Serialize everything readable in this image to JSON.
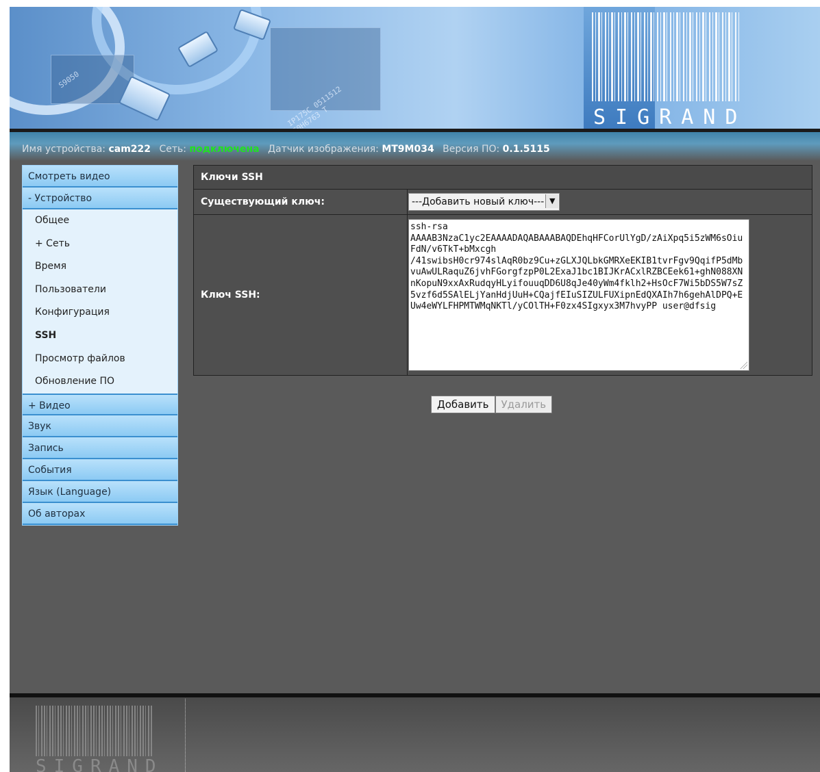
{
  "header": {
    "logo_text": "SIGRAND",
    "chip_marking_1": "S9050",
    "chip_marking_2": "IP175C 0511512 F0H6763 T"
  },
  "status": {
    "device_label": "Имя устройства:",
    "device_name": "cam222",
    "network_label": "Сеть:",
    "network_state": "подключена",
    "network_state_color": "#22e022",
    "sensor_label": "Датчик изображения:",
    "sensor_value": "MT9M034",
    "firmware_label": "Версия ПО:",
    "firmware_value": "0.1.5115"
  },
  "sidebar": {
    "items": [
      {
        "label": "Смотреть видео"
      },
      {
        "label": "- Устройство"
      }
    ],
    "submenu": [
      {
        "label": "Общее"
      },
      {
        "label": "+ Сеть"
      },
      {
        "label": "Время"
      },
      {
        "label": "Пользователи"
      },
      {
        "label": "Конфигурация"
      },
      {
        "label": "SSH",
        "active": true
      },
      {
        "label": "Просмотр файлов"
      },
      {
        "label": "Обновление ПО"
      }
    ],
    "items_after": [
      {
        "label": "+ Видео"
      },
      {
        "label": "Звук"
      },
      {
        "label": "Запись"
      },
      {
        "label": "События"
      },
      {
        "label": "Язык (Language)"
      },
      {
        "label": "Об авторах"
      }
    ]
  },
  "main": {
    "section_title": "Ключи SSH",
    "existing_key_label": "Существующий ключ:",
    "existing_key_select_value": "---Добавить новый ключ---",
    "ssh_key_label": "Ключ SSH:",
    "ssh_key_value": "ssh-rsa\nAAAAB3NzaC1yc2EAAAADAQABAAABAQDEhqHFCorUlYgD/zAiXpq5i5zWM6sOiuFdN/v6TkT+bMxcgh\n/41swibsH0cr974slAqR0bz9Cu+zGLXJQLbkGMRXeEKIB1tvrFgv9QqifP5dMbvuAwULRaquZ6jvhFGorgfzpP0L2ExaJ1bc1BIJKrACxlRZBCEek61+ghN088XNnKopuN9xxAxRudqyHLyifouuqDD6U8qJe40yWm4fklh2+HsOcF7Wi5bDS5W7sZ5vzf6d5SAlELjYanHdjUuH+CQajfEIuSIZULFUXipnEdQXAIh7h6gehAlDPQ+EUw4eWYLFHPMTWMqNKTl/yCOlTH+F0zx4SIgxyx3M7hvyPP user@dfsig",
    "add_button": "Добавить",
    "delete_button": "Удалить"
  },
  "footer": {
    "logo_text": "SIGRAND"
  }
}
